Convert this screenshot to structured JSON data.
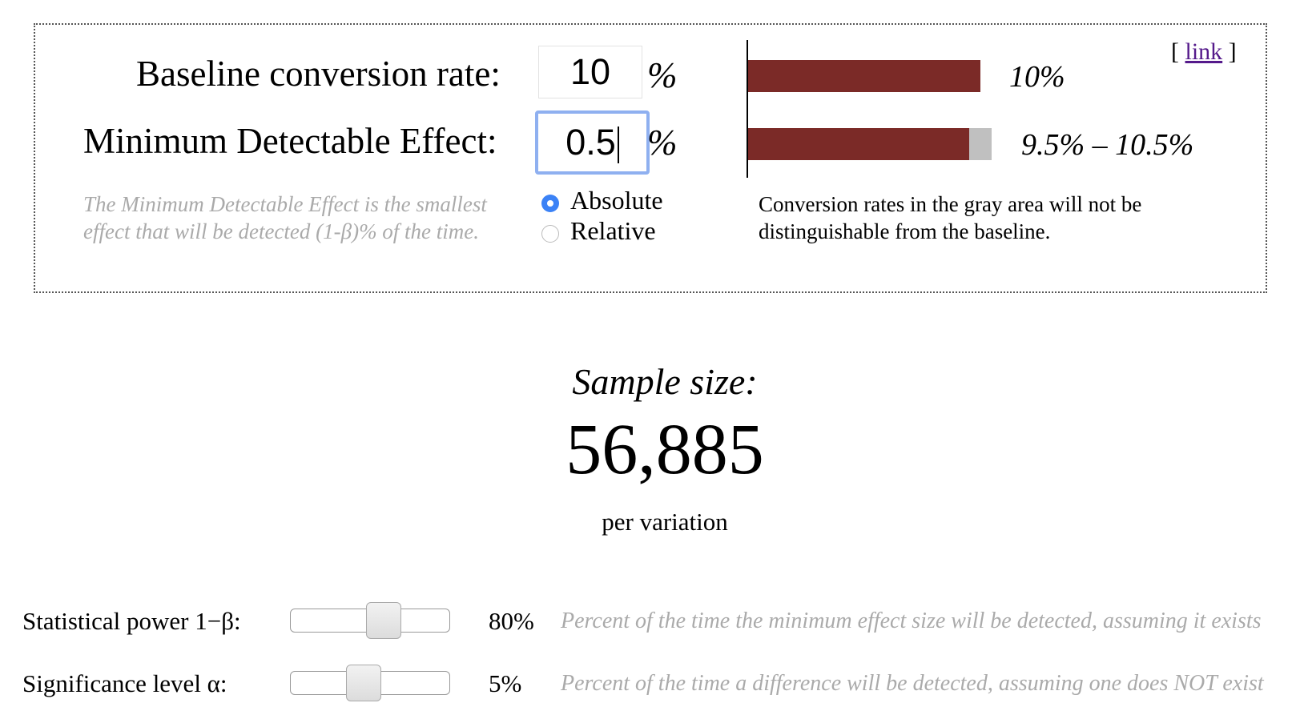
{
  "calculator": {
    "link_open": "[",
    "link_text": "link",
    "link_close": "]",
    "baseline_label": "Baseline conversion rate:",
    "baseline_value": "10",
    "mde_label": "Minimum Detectable Effect:",
    "mde_value": "0.5",
    "percent_sign": "%",
    "mde_help": [
      "The Minimum Detectable Effect is the smallest",
      "effect that will be detected (1-β)% of the time."
    ],
    "mode_options": [
      {
        "label": "Absolute",
        "selected": true
      },
      {
        "label": "Relative",
        "selected": false
      }
    ],
    "baseline_bar_label": "10%",
    "range_bar_label": "9.5% – 10.5%",
    "gray_note": [
      "Conversion rates in the gray area will not be",
      "distinguishable from the baseline."
    ],
    "bar_colors": {
      "red": "#7b2a27",
      "gray": "#c0c0c0"
    }
  },
  "result": {
    "title": "Sample size:",
    "value": "56,885",
    "unit": "per variation"
  },
  "settings": [
    {
      "label": "Statistical power 1−β:",
      "value": "80%",
      "level": 0.8,
      "help": "Percent of the time the minimum effect size will be detected, assuming it exists"
    },
    {
      "label": "Significance level α:",
      "value": "5%",
      "level": 0.05,
      "help": "Percent of the time a difference will be detected, assuming one does NOT exist"
    }
  ]
}
